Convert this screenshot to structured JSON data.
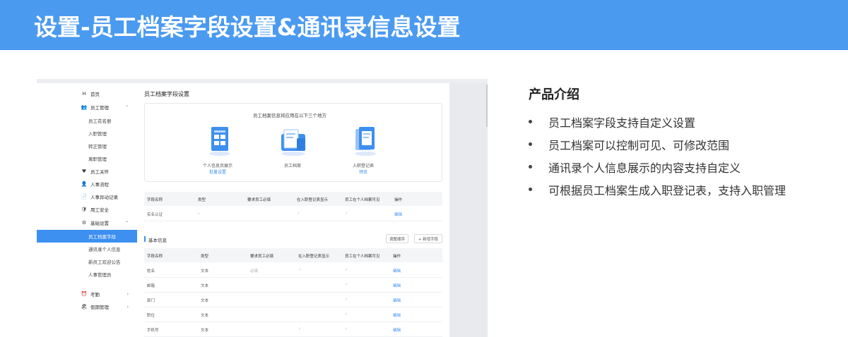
{
  "banner": {
    "title": "设置-员工档案字段设置&通讯录信息设置"
  },
  "sidebar": {
    "items": [
      {
        "icon": "H",
        "label": "首页"
      },
      {
        "icon": "👥",
        "label": "员工管理",
        "caret": "⌃"
      },
      {
        "label": "员工花名册"
      },
      {
        "label": "入职管理"
      },
      {
        "label": "转正管理"
      },
      {
        "label": "离职管理"
      },
      {
        "icon": "♥",
        "label": "员工关怀"
      },
      {
        "icon": "👤",
        "label": "人事流程"
      },
      {
        "icon": "📄",
        "label": "人事异动记录"
      },
      {
        "icon": "🛡",
        "label": "用工安全"
      },
      {
        "icon": "⚙",
        "label": "基础设置",
        "caret": "⌃"
      },
      {
        "label": "员工档案字段",
        "active": true
      },
      {
        "label": "通讯录个人信息"
      },
      {
        "label": "新员工欢迎公告"
      },
      {
        "label": "人事管理员"
      },
      {
        "icon": "⏰",
        "label": "考勤",
        "caret": "›"
      },
      {
        "icon": "🏖",
        "label": "假期管理",
        "caret": "›"
      }
    ]
  },
  "content": {
    "page_title": "员工档案字段设置",
    "card_title": "员工档案信息将应用在以下三个地方",
    "places": [
      {
        "caption": "个人信息页展示",
        "link": "批量设置"
      },
      {
        "caption": "员工档案",
        "link": ""
      },
      {
        "caption": "入职登记表",
        "link": "预览"
      }
    ],
    "table1": {
      "headers": [
        "字段名称",
        "类型",
        "要求员工必填",
        "在入职登记表显示",
        "员工在个人档案可见",
        "操作"
      ],
      "rows": [
        {
          "name": "实名认证",
          "type": "-",
          "required": "",
          "show_reg": "✓",
          "visible": "✓",
          "action": "编辑"
        }
      ]
    },
    "section": {
      "label": "基本信息",
      "btn_order": "调整顺序",
      "btn_add": "+ 新增字段"
    },
    "table2": {
      "headers": [
        "字段名称",
        "类型",
        "要求员工必填",
        "在入职登记表显示",
        "员工在个人档案可见",
        "操作"
      ],
      "rows": [
        {
          "name": "姓名",
          "type": "文本",
          "required": "必填",
          "show_reg": "✓",
          "visible": "✓",
          "action": "编辑"
        },
        {
          "name": "邮箱",
          "type": "文本",
          "required": "",
          "show_reg": "",
          "visible": "✓",
          "action": "编辑"
        },
        {
          "name": "部门",
          "type": "文本",
          "required": "",
          "show_reg": "",
          "visible": "✓",
          "action": "编辑"
        },
        {
          "name": "职位",
          "type": "文本",
          "required": "",
          "show_reg": "",
          "visible": "✓",
          "action": "编辑"
        },
        {
          "name": "手机号",
          "type": "文本",
          "required": "",
          "show_reg": "✓",
          "visible": "✓",
          "action": "编辑"
        }
      ]
    }
  },
  "intro": {
    "title": "产品介绍",
    "bullets": [
      "员工档案字段支持自定义设置",
      "员工档案可以控制可见、可修改范围",
      "通讯录个人信息展示的内容支持自定义",
      "可根据员工档案生成入职登记表，支持入职管理"
    ]
  },
  "colors": {
    "banner": "#4a9af0",
    "accent": "#3d8ff0"
  }
}
